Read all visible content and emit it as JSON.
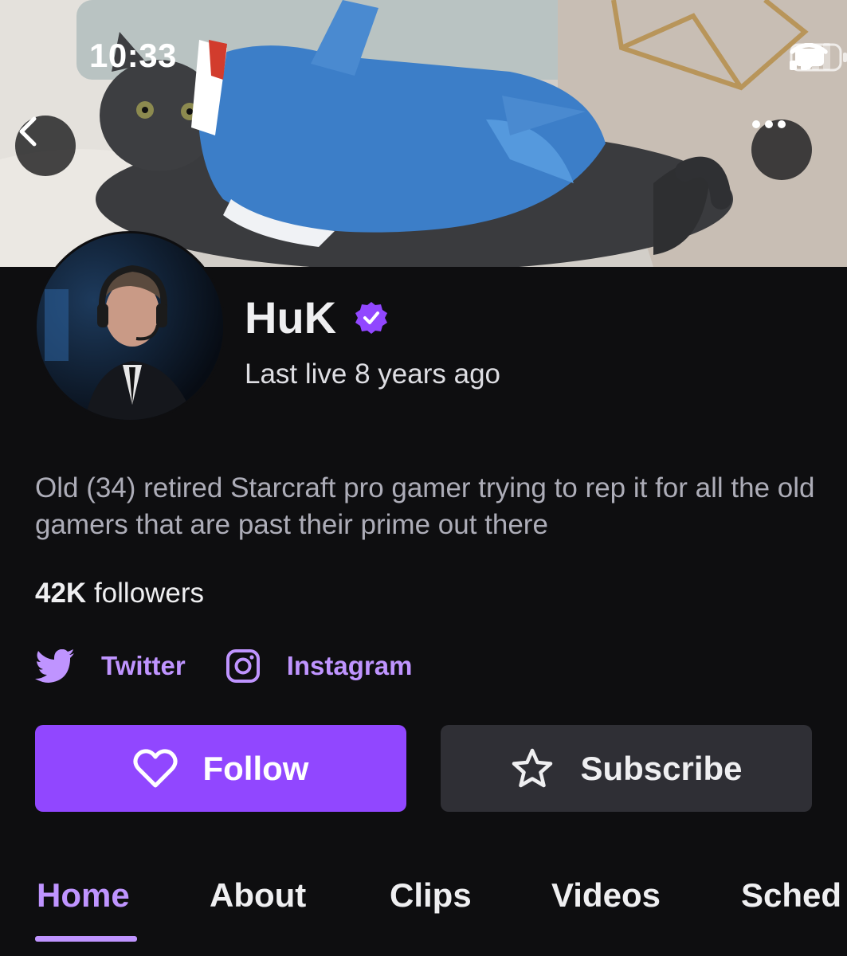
{
  "status_bar": {
    "time": "10:33"
  },
  "header": {
    "back_icon": "chevron-left-icon",
    "more_icon": "more-horizontal-icon"
  },
  "channel": {
    "name": "HuK",
    "verified": true,
    "last_live": "Last live 8 years ago",
    "bio": "Old (34) retired Starcraft pro gamer trying to rep it for all the old gamers that are past their prime out there",
    "followers_count": "42K",
    "followers_label": "followers"
  },
  "socials": [
    {
      "label": "Twitter",
      "icon": "twitter-icon"
    },
    {
      "label": "Instagram",
      "icon": "instagram-icon"
    }
  ],
  "actions": {
    "follow_label": "Follow",
    "subscribe_label": "Subscribe"
  },
  "tabs": [
    {
      "label": "Home",
      "active": true
    },
    {
      "label": "About",
      "active": false
    },
    {
      "label": "Clips",
      "active": false
    },
    {
      "label": "Videos",
      "active": false
    },
    {
      "label": "Sched",
      "active": false
    }
  ],
  "colors": {
    "accent": "#9147ff",
    "accent_text": "#bf94ff",
    "background": "#0e0e10",
    "secondary_button": "#2f2f35"
  }
}
